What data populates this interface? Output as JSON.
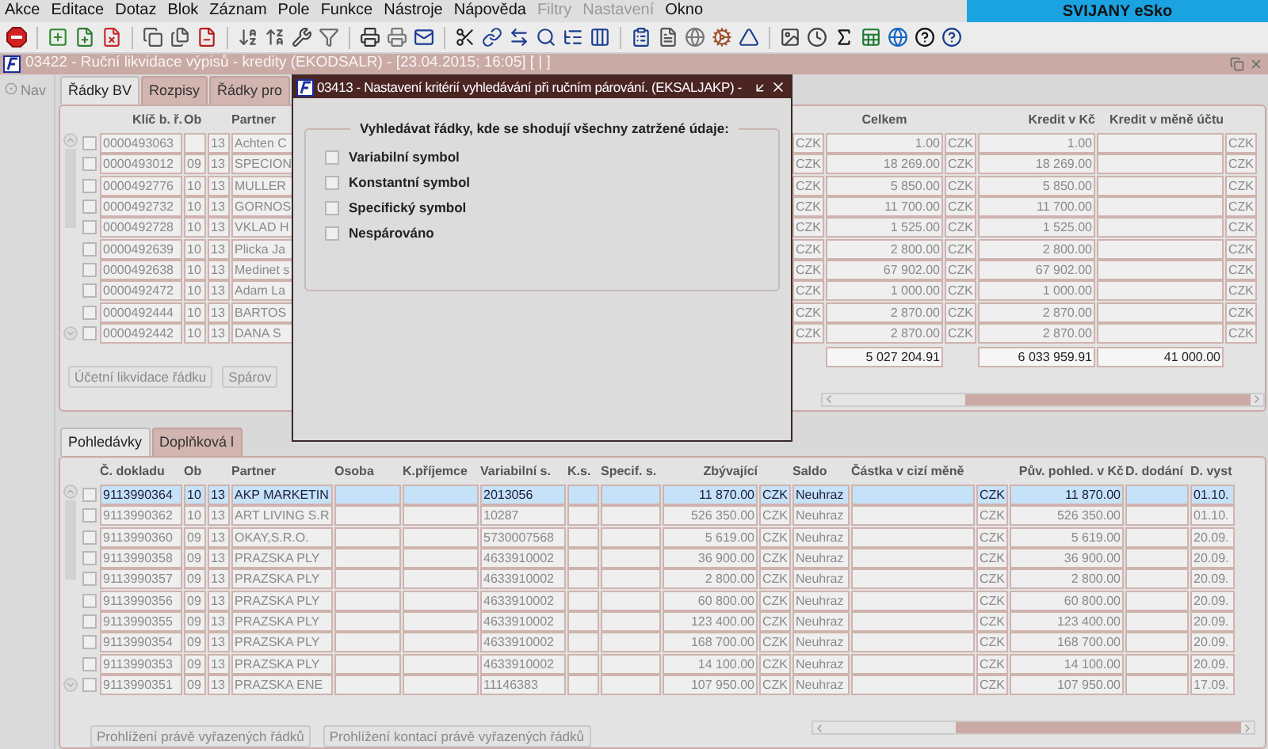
{
  "menu": [
    {
      "label": "Akce",
      "disabled": false
    },
    {
      "label": "Editace",
      "disabled": false
    },
    {
      "label": "Dotaz",
      "disabled": false
    },
    {
      "label": "Blok",
      "disabled": false
    },
    {
      "label": "Záznam",
      "disabled": false
    },
    {
      "label": "Pole",
      "disabled": false
    },
    {
      "label": "Funkce",
      "disabled": false
    },
    {
      "label": "Nástroje",
      "disabled": false
    },
    {
      "label": "Nápověda",
      "disabled": false
    },
    {
      "label": "Filtry",
      "disabled": true
    },
    {
      "label": "Nastavení",
      "disabled": true
    },
    {
      "label": "Okno",
      "disabled": false
    }
  ],
  "brand": "SVIJANY eSko",
  "window_title": "03422 - Ruční likvidace výpisů - kredity (EKODSALR) - [23.04.2015; 16:05] [ | ]",
  "nav_label": "Nav",
  "upper": {
    "tabs": [
      {
        "label": "Řádky BV",
        "selected": true
      },
      {
        "label": "Rozpisy",
        "selected": false
      },
      {
        "label": "Řádky pro",
        "selected": false
      }
    ],
    "columns": [
      "Klíč b. ř.",
      "Ob",
      "Partner",
      "Celkem",
      "Kredit v Kč",
      "Kredit v měně účtu"
    ],
    "rows": [
      {
        "checked": false,
        "key": "0000493063",
        "code": "13",
        "partner": "Achten C",
        "cur1": "CZK",
        "total": "1.00",
        "cur2": "CZK",
        "credit": "1.00",
        "cur3": "CZK"
      },
      {
        "checked": false,
        "key": "0000493012",
        "ob": "09",
        "code": "13",
        "partner": "SPECION",
        "cur1": "CZK",
        "total": "18 269.00",
        "cur2": "CZK",
        "credit": "18 269.00",
        "cur3": "CZK"
      },
      {
        "checked": false,
        "key": "0000492776",
        "ob": "10",
        "code": "13",
        "partner": "MULLER",
        "cur1": "CZK",
        "total": "5 850.00",
        "cur2": "CZK",
        "credit": "5 850.00",
        "cur3": "CZK"
      },
      {
        "checked": false,
        "key": "0000492732",
        "ob": "10",
        "code": "13",
        "partner": "GORNOS",
        "cur1": "CZK",
        "total": "11 700.00",
        "cur2": "CZK",
        "credit": "11 700.00",
        "cur3": "CZK"
      },
      {
        "checked": false,
        "key": "0000492728",
        "ob": "10",
        "code": "13",
        "partner": "VKLAD H",
        "cur1": "CZK",
        "total": "1 525.00",
        "cur2": "CZK",
        "credit": "1 525.00",
        "cur3": "CZK"
      },
      {
        "checked": false,
        "key": "0000492639",
        "ob": "10",
        "code": "13",
        "partner": "Plicka Ja",
        "cur1": "CZK",
        "total": "2 800.00",
        "cur2": "CZK",
        "credit": "2 800.00",
        "cur3": "CZK"
      },
      {
        "checked": false,
        "key": "0000492638",
        "ob": "10",
        "code": "13",
        "partner": "Medinet s",
        "cur1": "CZK",
        "total": "67 902.00",
        "cur2": "CZK",
        "credit": "67 902.00",
        "cur3": "CZK"
      },
      {
        "checked": false,
        "key": "0000492472",
        "ob": "10",
        "code": "13",
        "partner": "Adam La",
        "cur1": "CZK",
        "total": "1 000.00",
        "cur2": "CZK",
        "credit": "1 000.00",
        "cur3": "CZK"
      },
      {
        "checked": false,
        "key": "0000492444",
        "ob": "10",
        "code": "13",
        "partner": "BARTOS",
        "cur1": "CZK",
        "total": "2 870.00",
        "cur2": "CZK",
        "credit": "2 870.00",
        "cur3": "CZK"
      },
      {
        "checked": false,
        "key": "0000492442",
        "ob": "10",
        "code": "13",
        "partner": "DANA S",
        "cur1": "CZK",
        "total": "2 870.00",
        "cur2": "CZK",
        "credit": "2 870.00",
        "cur3": "CZK"
      }
    ],
    "totals": [
      "5 027 204.91",
      "6 033 959.91",
      "41 000.00"
    ],
    "buttons": [
      "Účetní likvidace řádku",
      "Spárov"
    ]
  },
  "lower": {
    "tabs": [
      {
        "label": "Pohledávky",
        "selected": true
      },
      {
        "label": "Doplňková l",
        "selected": false
      }
    ],
    "columns": [
      "Č. dokladu",
      "Ob",
      "Partner",
      "Osoba",
      "K.příjemce",
      "Variabilní s.",
      "K.s.",
      "Specif. s.",
      "Zbývající",
      "Saldo",
      "Částka v cizí měně",
      "Pův. pohled. v Kč",
      "D. dodání",
      "D. vyst"
    ],
    "rows": [
      {
        "selected": true,
        "checked": false,
        "doc": "9113990364",
        "ob": "10",
        "code": "13",
        "partner": "AKP MARKETIN",
        "vs": "2013056",
        "rem": "11 870.00",
        "cur": "CZK",
        "saldo": "Neuhraz",
        "cur2": "CZK",
        "orig": "11 870.00",
        "dvyst": "01.10."
      },
      {
        "selected": false,
        "checked": false,
        "doc": "9113990362",
        "ob": "10",
        "code": "13",
        "partner": "ART LIVING S.R",
        "vs": "10287",
        "rem": "526 350.00",
        "cur": "CZK",
        "saldo": "Neuhraz",
        "cur2": "CZK",
        "orig": "526 350.00",
        "dvyst": "01.10."
      },
      {
        "selected": false,
        "checked": false,
        "doc": "9113990360",
        "ob": "09",
        "code": "13",
        "partner": "OKAY,S.R.O.",
        "vs": "5730007568",
        "rem": "5 619.00",
        "cur": "CZK",
        "saldo": "Neuhraz",
        "cur2": "CZK",
        "orig": "5 619.00",
        "dvyst": "20.09."
      },
      {
        "selected": false,
        "checked": false,
        "doc": "9113990358",
        "ob": "09",
        "code": "13",
        "partner": "PRAZSKA PLY",
        "vs": "4633910002",
        "rem": "36 900.00",
        "cur": "CZK",
        "saldo": "Neuhraz",
        "cur2": "CZK",
        "orig": "36 900.00",
        "dvyst": "20.09."
      },
      {
        "selected": false,
        "checked": false,
        "doc": "9113990357",
        "ob": "09",
        "code": "13",
        "partner": "PRAZSKA PLY",
        "vs": "4633910002",
        "rem": "2 800.00",
        "cur": "CZK",
        "saldo": "Neuhraz",
        "cur2": "CZK",
        "orig": "2 800.00",
        "dvyst": "20.09."
      },
      {
        "selected": false,
        "checked": false,
        "doc": "9113990356",
        "ob": "09",
        "code": "13",
        "partner": "PRAZSKA PLY",
        "vs": "4633910002",
        "rem": "60 800.00",
        "cur": "CZK",
        "saldo": "Neuhraz",
        "cur2": "CZK",
        "orig": "60 800.00",
        "dvyst": "20.09."
      },
      {
        "selected": false,
        "checked": false,
        "doc": "9113990355",
        "ob": "09",
        "code": "13",
        "partner": "PRAZSKA PLY",
        "vs": "4633910002",
        "rem": "123 400.00",
        "cur": "CZK",
        "saldo": "Neuhraz",
        "cur2": "CZK",
        "orig": "123 400.00",
        "dvyst": "20.09."
      },
      {
        "selected": false,
        "checked": false,
        "doc": "9113990354",
        "ob": "09",
        "code": "13",
        "partner": "PRAZSKA PLY",
        "vs": "4633910002",
        "rem": "168 700.00",
        "cur": "CZK",
        "saldo": "Neuhraz",
        "cur2": "CZK",
        "orig": "168 700.00",
        "dvyst": "20.09."
      },
      {
        "selected": false,
        "checked": false,
        "doc": "9113990353",
        "ob": "09",
        "code": "13",
        "partner": "PRAZSKA PLY",
        "vs": "4633910002",
        "rem": "14 100.00",
        "cur": "CZK",
        "saldo": "Neuhraz",
        "cur2": "CZK",
        "orig": "14 100.00",
        "dvyst": "20.09."
      },
      {
        "selected": false,
        "checked": false,
        "doc": "9113990351",
        "ob": "09",
        "code": "13",
        "partner": "PRAZSKA ENE",
        "vs": "11146383",
        "rem": "107 950.00",
        "cur": "CZK",
        "saldo": "Neuhraz",
        "cur2": "CZK",
        "orig": "107 950.00",
        "dvyst": "17.09."
      }
    ],
    "buttons": [
      "Prohlížení právě vyřazených řádků",
      "Prohlížení kontací právě vyřazených řádků"
    ]
  },
  "dialog": {
    "title": "03413 - Nastavení kritérií vyhledávání při ručním párování. (EKSALJAKP) -",
    "group_label": "Vyhledávat řádky, kde se shodují všechny zatržené údaje:",
    "options": [
      {
        "label": "Variabilní symbol",
        "checked": false
      },
      {
        "label": "Konstantní symbol",
        "checked": false
      },
      {
        "label": "Specifický symbol",
        "checked": false
      },
      {
        "label": "Nespárováno",
        "checked": false
      }
    ]
  }
}
